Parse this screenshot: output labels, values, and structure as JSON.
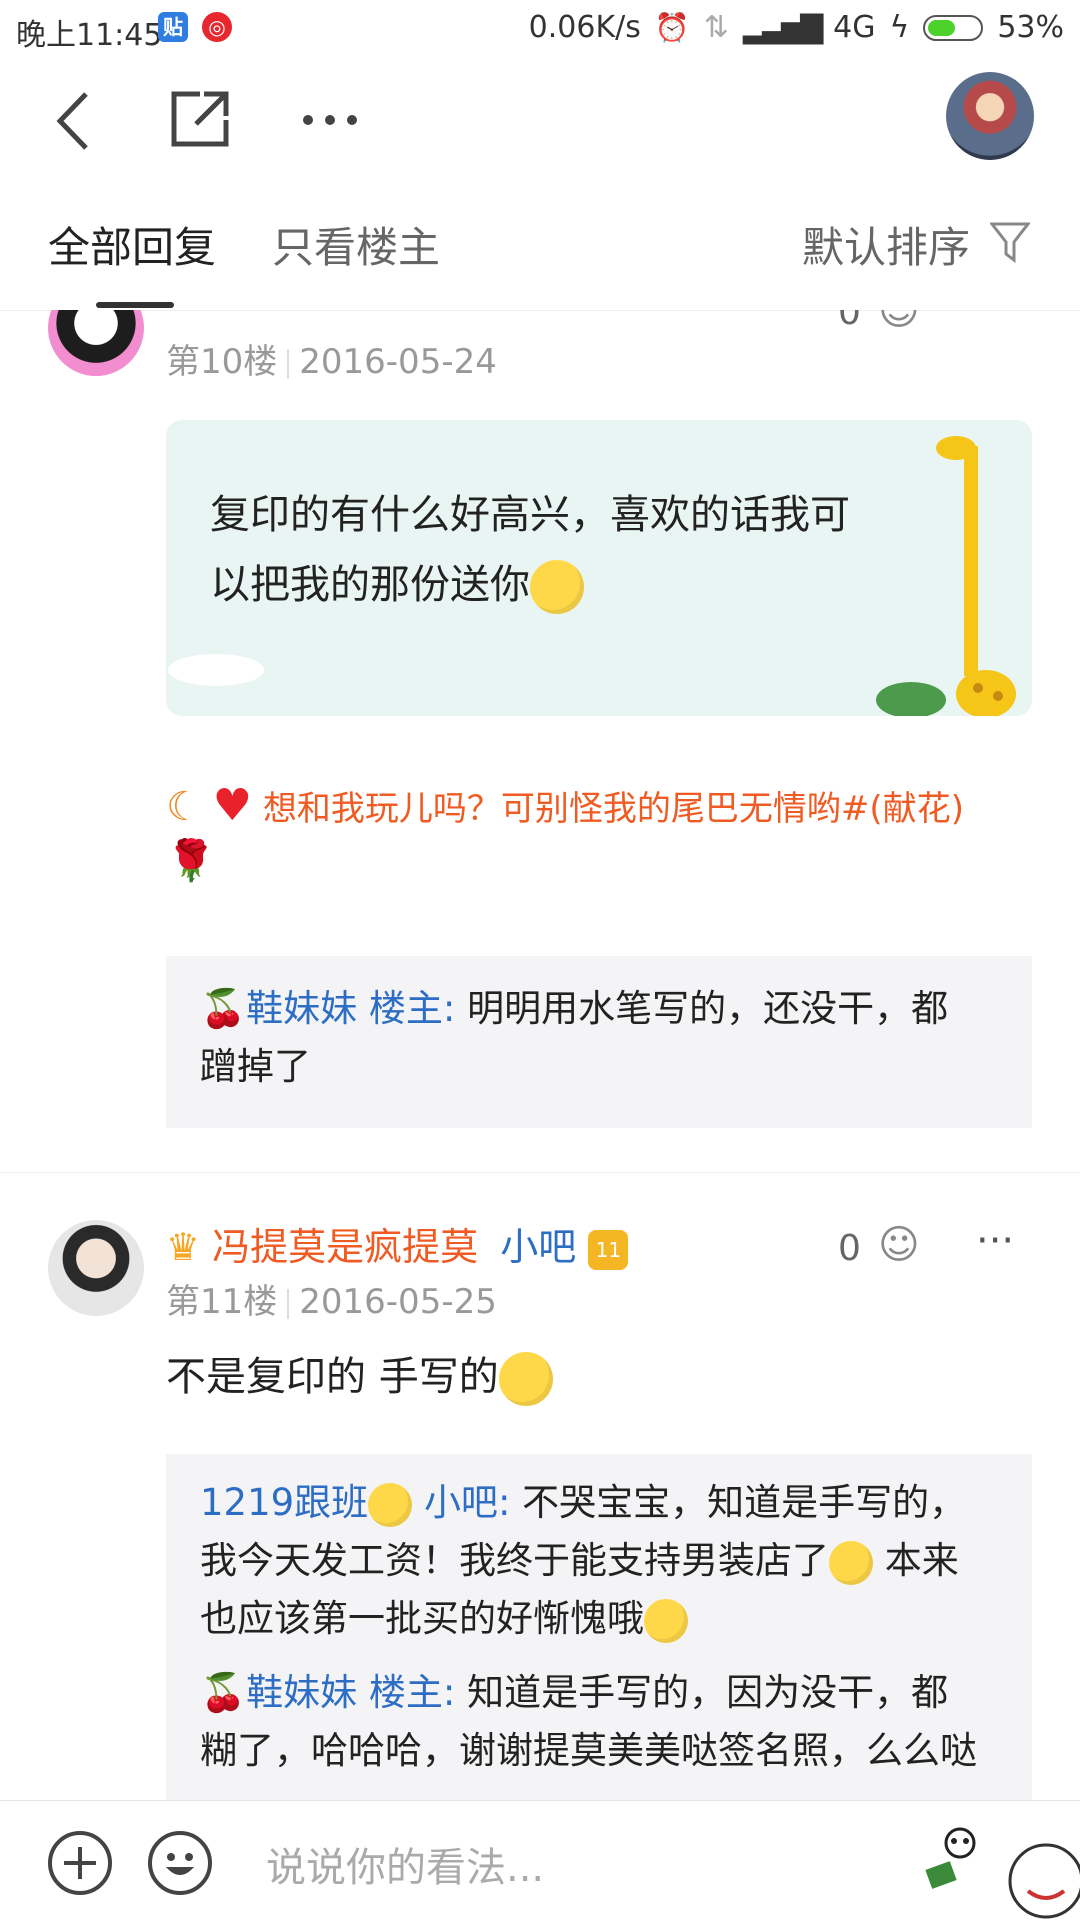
{
  "status_bar": {
    "time": "晚上11:45",
    "net_speed": "0.06K/s",
    "network": "4G",
    "battery": "53%",
    "battery_level": 0.53
  },
  "toolbar": {
    "back_icon": "back-chevron-icon",
    "share_icon": "share-icon",
    "more_icon": "more-dots-icon"
  },
  "tabs": {
    "all_replies": "全部回复",
    "only_op": "只看楼主",
    "sort": "默认排序"
  },
  "posts": [
    {
      "floor": "第10楼",
      "date": "2016-05-24",
      "likes": "0",
      "content_line1": "复印的有什么好高兴，喜欢的话我可",
      "content_line2": "以把我的那份送你",
      "signature": "想和我玩儿吗？可别怪我的尾巴无情哟#(献花)",
      "replies": [
        {
          "user": "鞋妹妹",
          "role": "楼主",
          "text_line1": "明明用水笔写的，还没干，都",
          "text_line2": "蹭掉了"
        }
      ]
    },
    {
      "username": "冯提莫是疯提莫",
      "role": "小吧",
      "level": "11",
      "floor": "第11楼",
      "date": "2016-05-25",
      "likes": "0",
      "content": "不是复印的 手写的",
      "replies": [
        {
          "user": "1219跟班",
          "role": "小吧",
          "text_line1": "不哭宝宝，知道是手写的，",
          "text_line2": "我今天发工资！我终于能支持男装店了",
          "text_line2b": "本来",
          "text_line3": "也应该第一批买的好惭愧哦"
        },
        {
          "user": "鞋妹妹",
          "role": "楼主",
          "text_line1": "知道是手写的，因为没干，都",
          "text_line2": "糊了，哈哈哈，谢谢提莫美美哒签名照，么么哒"
        }
      ]
    }
  ],
  "bottom_bar": {
    "placeholder": "说说你的看法..."
  }
}
